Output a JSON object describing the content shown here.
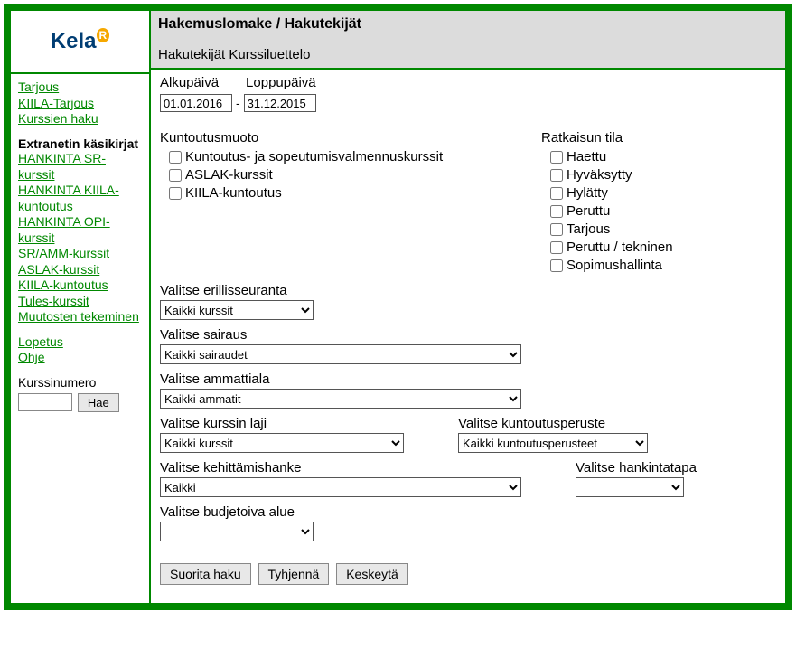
{
  "logo": {
    "text": "Kela",
    "badge": "R"
  },
  "nav": {
    "top": [
      "Tarjous",
      "KIILA-Tarjous",
      "Kurssien haku"
    ],
    "heading": "Extranetin käsikirjat",
    "handbooks": [
      "HANKINTA  SR-kurssit",
      "HANKINTA KIILA-kuntoutus",
      "HANKINTA OPI-kurssit",
      "SR/AMM-kurssit",
      "ASLAK-kurssit",
      "KIILA-kuntoutus",
      "Tules-kurssit",
      "Muutosten tekeminen"
    ],
    "bottom": [
      "Lopetus",
      "Ohje"
    ],
    "kurssi_label": "Kurssinumero",
    "hae": "Hae"
  },
  "header": {
    "title": "Hakemuslomake / Hakutekijät",
    "sub": "Hakutekijät Kurssiluettelo"
  },
  "dates": {
    "alku_label": "Alkupäivä",
    "loppu_label": "Loppupäivä",
    "alku": "01.01.2016",
    "loppu": "31.12.2015",
    "dash": "-"
  },
  "kuntoutus": {
    "label": "Kuntoutusmuoto",
    "opts": [
      "Kuntoutus- ja sopeutumisvalmennuskurssit",
      "ASLAK-kurssit",
      "KIILA-kuntoutus"
    ]
  },
  "ratkaisu": {
    "label": "Ratkaisun tila",
    "opts": [
      "Haettu",
      "Hyväksytty",
      "Hylätty",
      "Peruttu",
      "Tarjous",
      "Peruttu / tekninen",
      "Sopimushallinta"
    ]
  },
  "selects": {
    "erillis": {
      "label": "Valitse erillisseuranta",
      "value": "Kaikki kurssit"
    },
    "sairaus": {
      "label": "Valitse sairaus",
      "value": "Kaikki sairaudet"
    },
    "ammatti": {
      "label": "Valitse ammattiala",
      "value": "Kaikki ammatit"
    },
    "laji": {
      "label": "Valitse kurssin laji",
      "value": "Kaikki kurssit"
    },
    "peruste": {
      "label": "Valitse kuntoutusperuste",
      "value": "Kaikki kuntoutusperusteet"
    },
    "kehitys": {
      "label": "Valitse kehittämishanke",
      "value": "Kaikki"
    },
    "hankinta": {
      "label": "Valitse hankintatapa",
      "value": ""
    },
    "budjetti": {
      "label": "Valitse budjetoiva alue",
      "value": ""
    }
  },
  "buttons": {
    "suorita": "Suorita haku",
    "tyhjenna": "Tyhjennä",
    "keskeyta": "Keskeytä"
  }
}
